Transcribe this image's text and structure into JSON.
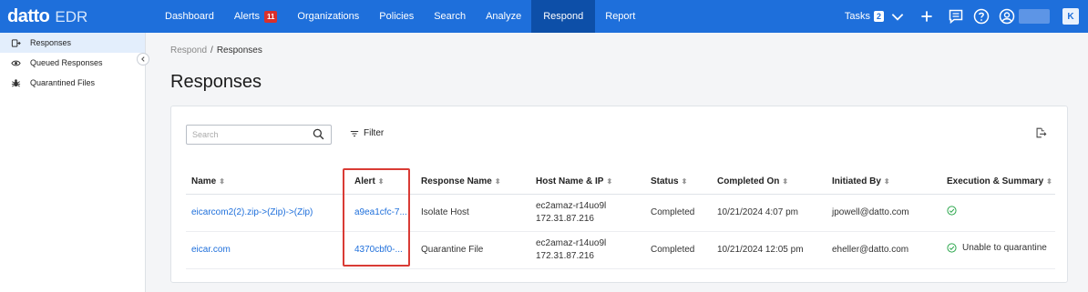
{
  "app": {
    "brand": "datto",
    "product": "EDR"
  },
  "nav": {
    "items": [
      {
        "label": "Dashboard",
        "active": false
      },
      {
        "label": "Alerts",
        "badge": "11",
        "active": false
      },
      {
        "label": "Organizations",
        "active": false
      },
      {
        "label": "Policies",
        "active": false
      },
      {
        "label": "Search",
        "active": false
      },
      {
        "label": "Analyze",
        "active": false
      },
      {
        "label": "Respond",
        "active": true
      },
      {
        "label": "Report",
        "active": false
      }
    ],
    "tasks_label": "Tasks",
    "tasks_count": "2",
    "user_initial": "K"
  },
  "sidebar": {
    "items": [
      {
        "label": "Responses",
        "icon": "responses-icon",
        "active": true
      },
      {
        "label": "Queued Responses",
        "icon": "eye-icon",
        "active": false
      },
      {
        "label": "Quarantined Files",
        "icon": "bug-icon",
        "active": false
      }
    ]
  },
  "breadcrumb": {
    "parent": "Respond",
    "separator": "/",
    "current": "Responses"
  },
  "page": {
    "title": "Responses"
  },
  "toolbar": {
    "search_placeholder": "Search",
    "filter_label": "Filter"
  },
  "table": {
    "columns": [
      "Name",
      "Alert",
      "Response Name",
      "Host Name & IP",
      "Status",
      "Completed On",
      "Initiated By",
      "Execution & Summary"
    ],
    "rows": [
      {
        "name": "eicarcom2(2).zip->(Zip)->(Zip)",
        "alert": "a9ea1cfc-7...",
        "response_name": "Isolate Host",
        "host_name": "ec2amaz-r14uo9l",
        "host_ip": "172.31.87.216",
        "status": "Completed",
        "completed_on": "10/21/2024 4:07 pm",
        "initiated_by": "jpowell@datto.com",
        "summary": ""
      },
      {
        "name": "eicar.com",
        "alert": "4370cbf0-...",
        "response_name": "Quarantine File",
        "host_name": "ec2amaz-r14uo9l",
        "host_ip": "172.31.87.216",
        "status": "Completed",
        "completed_on": "10/21/2024 12:05 pm",
        "initiated_by": "eheller@datto.com",
        "summary": "Unable to quarantine"
      }
    ]
  },
  "colors": {
    "primary": "#1e6fdb",
    "nav_active": "#0d4fa8",
    "badge": "#d9302c",
    "success": "#2fa84f",
    "highlight": "#d93b35"
  }
}
